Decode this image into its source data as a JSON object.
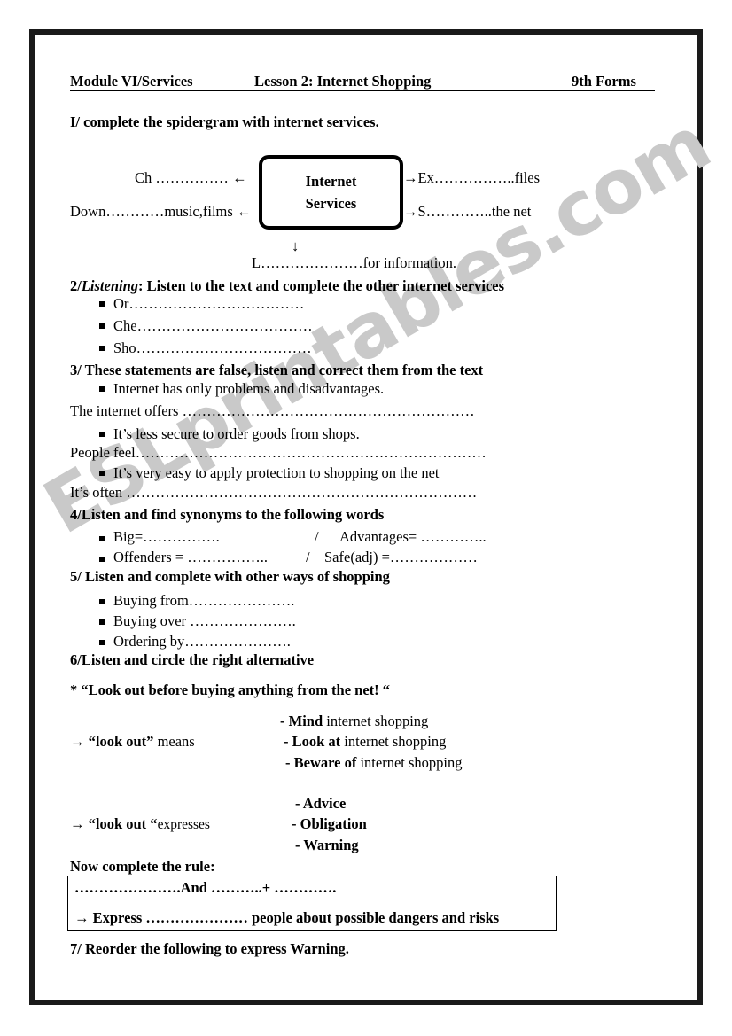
{
  "watermark": {
    "text": "ESLprintables.com"
  },
  "header": {
    "module": "Module VI/Services",
    "lesson": "Lesson 2: Internet Shopping",
    "forms": "9th Forms"
  },
  "task1": {
    "title": "I/ complete the spidergram with internet services.",
    "center": {
      "line1": "Internet",
      "line2": "Services"
    },
    "branches": {
      "top_left": "Ch …………… ←",
      "bottom_left": "Down…………music,films ←",
      "top_right": "→Ex……………..files",
      "bottom_right": "→S…………..the net",
      "down_arrow": "↓",
      "bottom": "L…………………for information."
    }
  },
  "task2": {
    "number": "2/",
    "keyword": "Listening",
    "title": ": Listen to the text and complete the other internet services",
    "items": [
      "Or………………………………",
      "Che………………………………",
      "Sho………………………………"
    ]
  },
  "task3": {
    "title": "3/ These statements are false, listen and correct them from the text",
    "pairs": [
      {
        "statement": "Internet has only problems and disadvantages.",
        "answer": "The internet offers ……………………………………………………"
      },
      {
        "statement": "It’s less secure to order goods from shops.",
        "answer": "People feel………………………………………………………………"
      },
      {
        "statement": "It’s very easy to apply protection to shopping on the net",
        "answer": "It’s often ………………………………………………………………"
      }
    ]
  },
  "task4": {
    "title": "4/Listen and find synonyms to the following words",
    "rows": [
      {
        "left": "Big=…………….",
        "sep": "/",
        "right": "Advantages= ………….."
      },
      {
        "left": "Offenders = ……………..",
        "sep": "/",
        "right": "Safe(adj) =………………"
      }
    ]
  },
  "task5": {
    "title": "5/ Listen and complete with other ways of shopping",
    "items": [
      "Buying from………………….",
      "Buying over ………………….",
      "Ordering by…………………."
    ]
  },
  "task6": {
    "title": "6/Listen and circle the right alternative",
    "quote": "* “Look out before buying anything from the net! “",
    "q1": {
      "stem_arrow": "→",
      "stem_quoted": "“look out”",
      "stem_rest": "means",
      "options": [
        {
          "bold": "- Mind",
          "rest": " internet shopping"
        },
        {
          "bold": "- Look at",
          "rest": " internet shopping"
        },
        {
          "bold": "- Beware of",
          "rest": " internet shopping"
        }
      ]
    },
    "q2": {
      "stem_arrow": "→",
      "stem_quoted": "“look out “",
      "stem_rest": "expresses",
      "options": [
        {
          "bold": "- Advice",
          "rest": ""
        },
        {
          "bold": "- Obligation",
          "rest": ""
        },
        {
          "bold": "- Warning",
          "rest": ""
        }
      ]
    },
    "rule_title": "Now complete the rule:",
    "rule_line1": "………………….And ………..+ ………….",
    "rule_line2": "→ Express ………………… people about possible dangers and risks"
  },
  "task7": {
    "title": "7/ Reorder the following to express Warning."
  }
}
